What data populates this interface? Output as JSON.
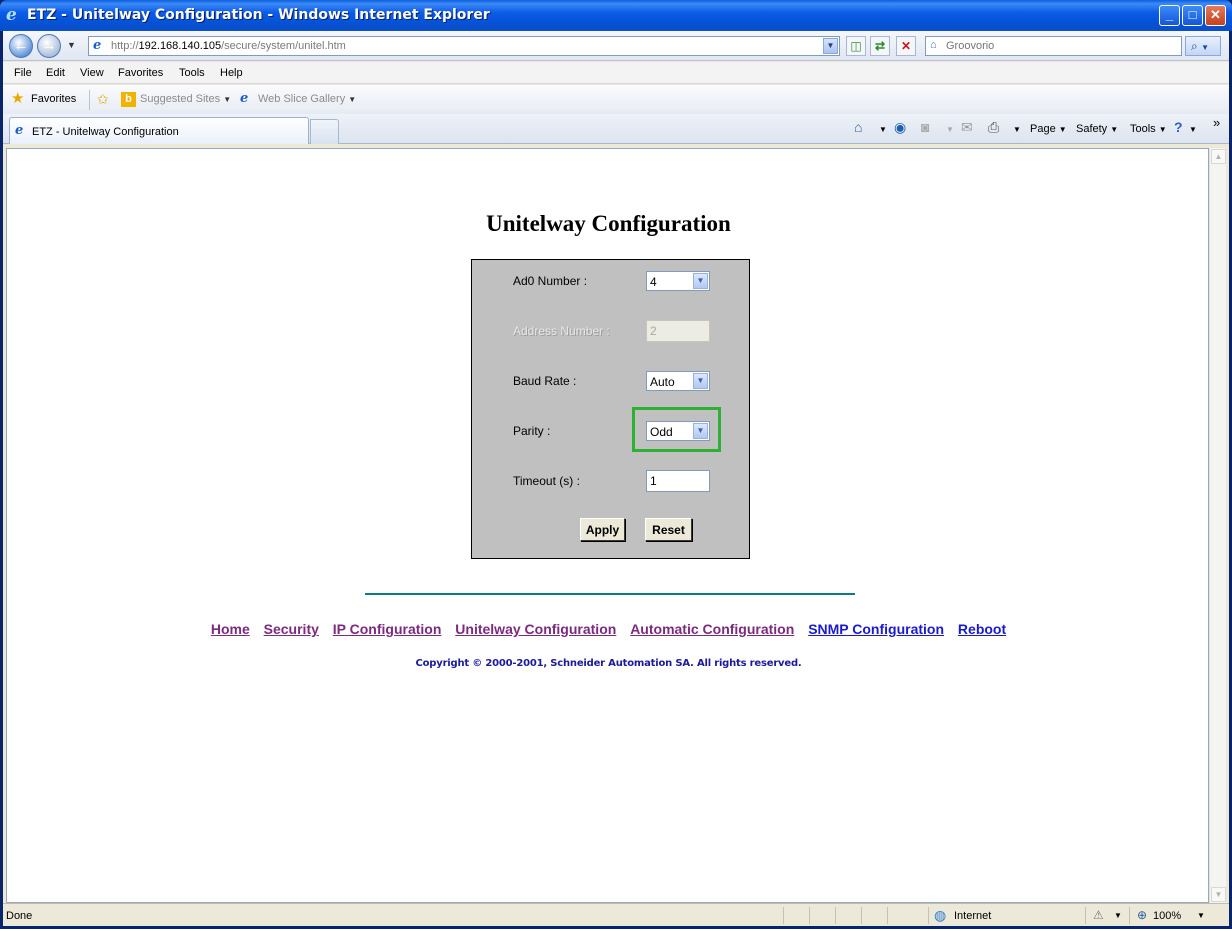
{
  "window": {
    "title": "ETZ - Unitelway Configuration - Windows Internet Explorer",
    "minimize": "_",
    "maximize": "□",
    "close": "✕"
  },
  "address": {
    "prefix": "http://",
    "host": "192.168.140.105",
    "path": "/secure/system/unitel.htm"
  },
  "search": {
    "placeholder": "Groovorio"
  },
  "menu": [
    "File",
    "Edit",
    "View",
    "Favorites",
    "Tools",
    "Help"
  ],
  "favorites_bar": {
    "favorites_label": "Favorites",
    "suggested_sites": "Suggested Sites",
    "web_slice_gallery": "Web Slice Gallery"
  },
  "tab": {
    "label": "ETZ - Unitelway Configuration"
  },
  "command_bar": {
    "page": "Page",
    "safety": "Safety",
    "tools": "Tools",
    "more": "»"
  },
  "page": {
    "title": "Unitelway Configuration",
    "fields": {
      "ad0_label": "Ad0 Number :",
      "ad0_value": "4",
      "address_label": "Address Number :",
      "address_value": "2",
      "baud_label": "Baud Rate :",
      "baud_value": "Auto",
      "parity_label": "Parity :",
      "parity_value": "Odd",
      "timeout_label": "Timeout (s) :",
      "timeout_value": "1"
    },
    "apply_label": "Apply",
    "reset_label": "Reset",
    "nav_links": [
      "Home",
      "Security",
      "IP Configuration",
      "Unitelway Configuration",
      "Automatic Configuration",
      "SNMP Configuration",
      "Reboot"
    ],
    "copyright": "Copyright © 2000-2001, Schneider Automation SA. All rights reserved."
  },
  "status": {
    "text": "Done",
    "zone": "Internet",
    "zoom": "100%"
  },
  "colors": {
    "highlight": "#2db034",
    "panel": "#c0c0c0",
    "divider": "#0c7d7d",
    "link_visited": "#7b2a7e",
    "link_unvisited": "#1a1acc"
  }
}
